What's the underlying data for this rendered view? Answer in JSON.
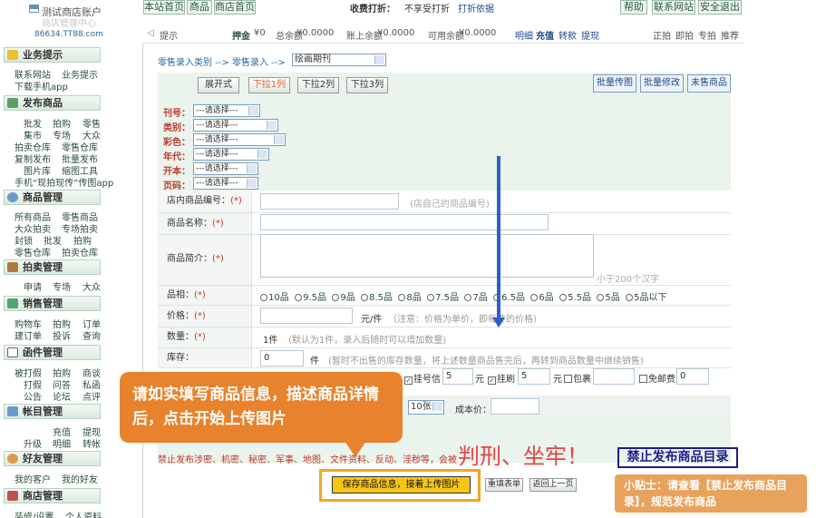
{
  "topbar": {
    "nav": [
      "本站首页",
      "商品",
      "商店首页"
    ],
    "fee_label": "收费打折：",
    "fee_value": "不享受打折",
    "fee_link": "打折依据",
    "right": [
      "帮助",
      "联系网站",
      "安全退出"
    ]
  },
  "logo": {
    "line1": "测试商店账户",
    "line2": "商店管理中心",
    "line3": "86634.TT88.com"
  },
  "toolbar2": {
    "tip": "提示",
    "deposit_label": "押金",
    "deposit": "¥0",
    "total_label": "总余额",
    "total": "¥0.0000",
    "account_label": "账上余额",
    "account": "¥0.0000",
    "available_label": "可用余额",
    "available": "¥0.0000",
    "links": [
      "明细",
      "充值",
      "转款",
      "提现"
    ],
    "right": [
      "正拍",
      "即拍",
      "专拍",
      "推荐"
    ]
  },
  "sidebar": {
    "sections": [
      {
        "title": "业务提示",
        "icon": "star-icon",
        "items": [
          "联系网站",
          "业务提示",
          "下载手机app"
        ]
      },
      {
        "title": "发布商品",
        "icon": "publish-icon",
        "items": [
          "批发",
          "拍购",
          "零售",
          "集市",
          "专场",
          "大众",
          "拍卖仓库",
          "零售仓库",
          "复制发布",
          "批量发布",
          "图片库",
          "缩图工具",
          "手机“现拍现传”传图app"
        ]
      },
      {
        "title": "商品管理",
        "icon": "search-icon",
        "items": [
          "所有商品",
          "零售商品",
          "大众拍卖",
          "专场拍卖",
          "封锁",
          "批发",
          "拍购",
          "零售仓库",
          "拍卖仓库"
        ]
      },
      {
        "title": "拍卖管理",
        "icon": "hammer-icon",
        "items": [
          "申请",
          "专场",
          "大众"
        ]
      },
      {
        "title": "销售管理",
        "icon": "cart-icon",
        "items": [
          "购物车",
          "拍购",
          "订单",
          "建订单",
          "投诉",
          "查询"
        ]
      },
      {
        "title": "函件管理",
        "icon": "mail-icon",
        "items": [
          "被打假",
          "拍购",
          "商谈",
          "打假",
          "问答",
          "私函",
          "公告",
          "论坛",
          "点评"
        ]
      },
      {
        "title": "帐目管理",
        "icon": "ledger-icon",
        "items": [
          "充值",
          "提现",
          "升级",
          "明细",
          "转帐"
        ]
      },
      {
        "title": "好友管理",
        "icon": "friends-icon",
        "items": [
          "我的客户",
          "我的好友"
        ]
      },
      {
        "title": "商店管理",
        "icon": "shop-icon",
        "items": [
          "装修/设置",
          "个人资料"
        ]
      }
    ]
  },
  "breadcrumb": {
    "a": "零售录入类别",
    "sep1": "-->",
    "b": "零售录入",
    "sep2": "-->",
    "select_value": "绘画期刊"
  },
  "panel": {
    "view_buttons": [
      "展开式",
      "下拉1列",
      "下拉2列",
      "下拉3列"
    ],
    "action_buttons": [
      "批量传图",
      "批量修改",
      "未售商品"
    ],
    "filters": [
      {
        "label": "刊号：",
        "value": "---请选择---"
      },
      {
        "label": "类别：",
        "value": "---请选择---"
      },
      {
        "label": "彩色：",
        "value": "---请选择---"
      },
      {
        "label": "年代：",
        "value": "---请选择---"
      },
      {
        "label": "开本：",
        "value": "---请选择---"
      },
      {
        "label": "页码：",
        "value": "---请选择---"
      }
    ]
  },
  "form": {
    "code_label": "店内商品编号：",
    "code_hint": "(店自己的商品编号)",
    "name_label": "商品名称：",
    "intro_label": "商品简介：",
    "intro_hint": "小于200个汉字",
    "grade_label": "品相：",
    "grades": [
      "10品",
      "9.5品",
      "9品",
      "8.5品",
      "8品",
      "7.5品",
      "7品",
      "6.5品",
      "6品",
      "5.5品",
      "5品",
      "5品以下"
    ],
    "price_label": "价格：",
    "price_unit": "元/件",
    "price_hint": "（注意：价格为单价，即每件的价格）",
    "qty_label": "数量：",
    "qty_value": "1件",
    "qty_hint": "(默认为1件，录入后随时可以增加数量)",
    "stock_label": "库存：",
    "stock_value": "0",
    "stock_unit": "件",
    "stock_hint": "(暂时不出售的库存数量，将上述数量商品售完后，再转到商品数量中继续销售)",
    "postage": [
      {
        "label": "挂号信",
        "value": "5",
        "unit": "元",
        "checked": true
      },
      {
        "label": "挂刷",
        "value": "5",
        "unit": "元",
        "checked": true
      },
      {
        "label": "包裹",
        "value": "",
        "unit": "",
        "checked": false
      },
      {
        "label": "免邮费",
        "value": "0",
        "unit": "",
        "checked": false
      }
    ],
    "img_count": "10张",
    "cost_label": "成本价："
  },
  "tooltip": {
    "text": "请如实填写商品信息，描述商品详情后，点击开始上传图片"
  },
  "warning": {
    "text": "禁止发布涉密、机密、秘密、军事、地图、文件资料、反动、淫秽等，会被",
    "big": "判刑、坐牢！",
    "link": "禁止发布商品目录"
  },
  "tip2": {
    "text": "小贴士：请查看【禁止发布商品目录】，规范发布商品"
  },
  "actions": {
    "save": "保存商品信息，接着上传图片",
    "reset": "重填表单",
    "back": "返回上一页"
  }
}
